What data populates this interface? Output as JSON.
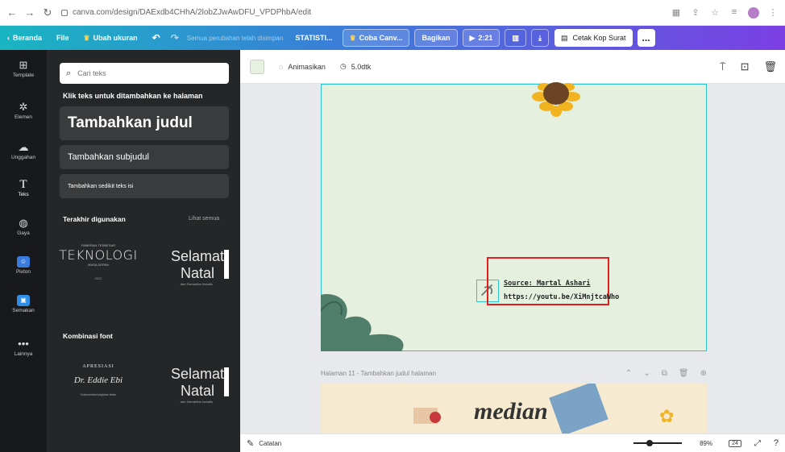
{
  "browser": {
    "url": "canva.com/design/DAExdb4CHhA/2lobZJwAwDFU_VPDPhbA/edit"
  },
  "toolbar": {
    "home": "Beranda",
    "file": "File",
    "resize": "Ubah ukuran",
    "saved_status": "Semua perubahan telah disimpan",
    "title": "STATISTI...",
    "try_canva": "Coba Canv...",
    "share": "Bagikan",
    "play_time": "2:21",
    "print_label": "Cetak Kop Surat",
    "more": "..."
  },
  "rail": {
    "items": [
      {
        "label": "Template",
        "icon": "layout-icon"
      },
      {
        "label": "Elemen",
        "icon": "shapes-icon"
      },
      {
        "label": "Unggahan",
        "icon": "upload-icon"
      },
      {
        "label": "Teks",
        "icon": "text-icon"
      },
      {
        "label": "Gaya",
        "icon": "palette-icon"
      },
      {
        "label": "Pixton",
        "icon": "pixton-icon"
      },
      {
        "label": "Semakan",
        "icon": "app-icon"
      },
      {
        "label": "Lainnya",
        "icon": "more-icon"
      }
    ]
  },
  "panel": {
    "search_placeholder": "Cari teks",
    "click_hint": "Klik teks untuk ditambahkan ke halaman",
    "add_heading": "Tambahkan judul",
    "add_subheading": "Tambahkan subjudul",
    "add_body": "Tambahkan sedikit teks isi",
    "recent_title": "Terakhir digunakan",
    "see_all": "Lihat semua",
    "recent_1_top": "PAMERAN TERBESAR",
    "recent_1_main": "TEKNOLOGI",
    "recent_1_sub": "MASA DEPAN",
    "recent_1_foot": "2022",
    "recent_2_main1": "Selamat",
    "recent_2_main2": "Natal",
    "recent_2_foot": "dari Samantha Nuvalls",
    "combo_title": "Kombinasi font",
    "combo_1_top": "APRESIASI",
    "combo_1_script": "Dr. Eddie Ebi",
    "combo_1_foot": "Dokumentasi kegiatan kelas",
    "combo_2_main1": "Selamat",
    "combo_2_main2": "Natal",
    "combo_2_foot": "dari Samantha Nuvalls"
  },
  "editor_bar": {
    "animate": "Animasikan",
    "duration": "5.0dtk"
  },
  "canvas": {
    "source_line1": "Source: Martal Ashari",
    "source_line2": "https://youtu.be/XiMnjtcaWho"
  },
  "page11": {
    "label": "Halaman 11 - Tambahkan judul halaman",
    "preview_text": "median"
  },
  "footer": {
    "notes": "Catatan",
    "zoom": "89%",
    "page_count": "24",
    "zoom_slider_level": 0.33
  },
  "colors": {
    "canvas_bg": "#e6f0de",
    "selection": "#2cc5cf",
    "highlight_box": "#e02020",
    "sidebar_bg": "#252627"
  }
}
